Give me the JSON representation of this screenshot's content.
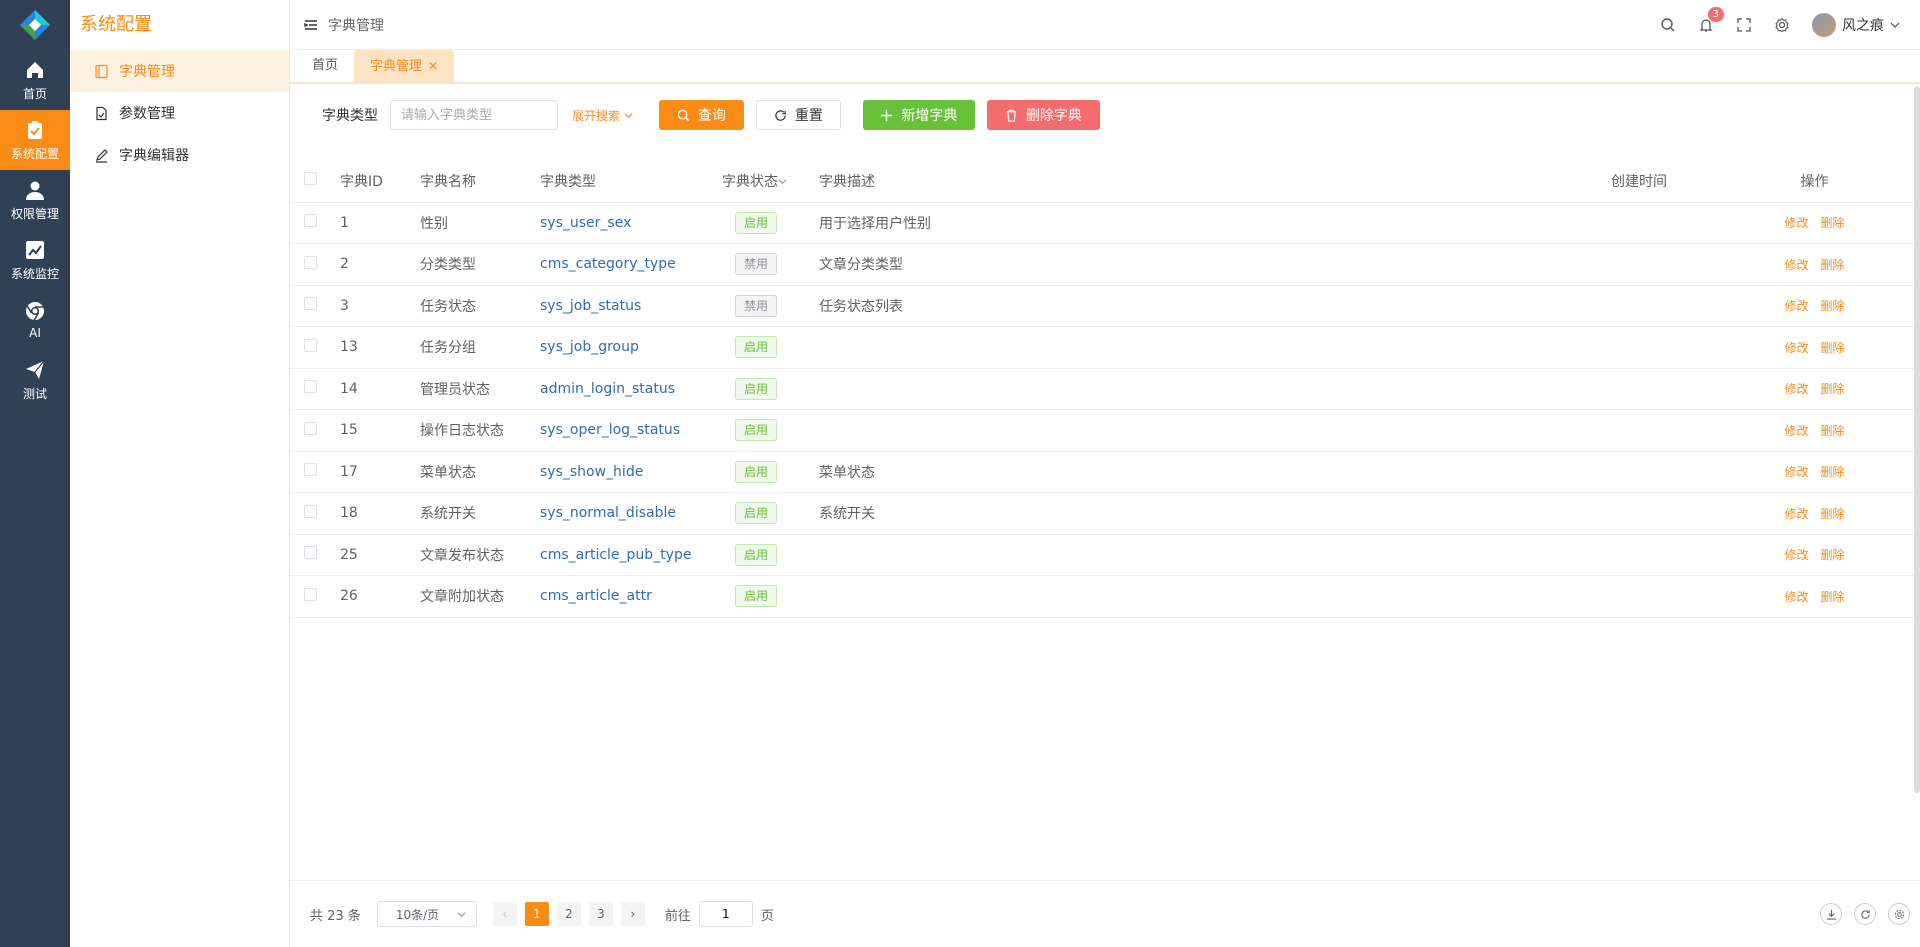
{
  "rail": {
    "items": [
      {
        "label": "首页",
        "icon": "home-icon"
      },
      {
        "label": "系统配置",
        "icon": "clipboard-check-icon",
        "active": true
      },
      {
        "label": "权限管理",
        "icon": "user-icon"
      },
      {
        "label": "系统监控",
        "icon": "chart-line-icon"
      },
      {
        "label": "AI",
        "icon": "chrome-icon"
      },
      {
        "label": "测试",
        "icon": "paper-plane-icon"
      }
    ]
  },
  "submenu": {
    "title": "系统配置",
    "items": [
      {
        "label": "字典管理",
        "active": true
      },
      {
        "label": "参数管理"
      },
      {
        "label": "字典编辑器"
      }
    ]
  },
  "header": {
    "breadcrumb": "字典管理",
    "notification_count": "3",
    "username": "风之痕"
  },
  "tabs": [
    {
      "label": "首页"
    },
    {
      "label": "字典管理",
      "active": true
    }
  ],
  "search": {
    "label": "字典类型",
    "placeholder": "请输入字典类型",
    "value": "",
    "expand_label": "展开搜索",
    "query_label": "查询",
    "reset_label": "重置",
    "add_label": "新增字典",
    "delete_label": "删除字典"
  },
  "table": {
    "headers": {
      "id": "字典ID",
      "name": "字典名称",
      "type": "字典类型",
      "state": "字典状态",
      "desc": "字典描述",
      "time": "创建时间",
      "op": "操作"
    },
    "edit_label": "修改",
    "delete_label": "删除",
    "rows": [
      {
        "id": "1",
        "name": "性别",
        "type": "sys_user_sex",
        "state": "启用",
        "on": true,
        "desc": "用于选择用户性别",
        "time": ""
      },
      {
        "id": "2",
        "name": "分类类型",
        "type": "cms_category_type",
        "state": "禁用",
        "on": false,
        "desc": "文章分类类型",
        "time": ""
      },
      {
        "id": "3",
        "name": "任务状态",
        "type": "sys_job_status",
        "state": "禁用",
        "on": false,
        "desc": "任务状态列表",
        "time": ""
      },
      {
        "id": "13",
        "name": "任务分组",
        "type": "sys_job_group",
        "state": "启用",
        "on": true,
        "desc": "",
        "time": ""
      },
      {
        "id": "14",
        "name": "管理员状态",
        "type": "admin_login_status",
        "state": "启用",
        "on": true,
        "desc": "",
        "time": ""
      },
      {
        "id": "15",
        "name": "操作日志状态",
        "type": "sys_oper_log_status",
        "state": "启用",
        "on": true,
        "desc": "",
        "time": ""
      },
      {
        "id": "17",
        "name": "菜单状态",
        "type": "sys_show_hide",
        "state": "启用",
        "on": true,
        "desc": "菜单状态",
        "time": ""
      },
      {
        "id": "18",
        "name": "系统开关",
        "type": "sys_normal_disable",
        "state": "启用",
        "on": true,
        "desc": "系统开关",
        "time": ""
      },
      {
        "id": "25",
        "name": "文章发布状态",
        "type": "cms_article_pub_type",
        "state": "启用",
        "on": true,
        "desc": "",
        "time": ""
      },
      {
        "id": "26",
        "name": "文章附加状态",
        "type": "cms_article_attr",
        "state": "启用",
        "on": true,
        "desc": "",
        "time": ""
      }
    ]
  },
  "pagination": {
    "total": "共 23 条",
    "page_size": "10条/页",
    "pages": [
      "1",
      "2",
      "3"
    ],
    "current": "1",
    "goto_label": "前往",
    "goto_value": "1",
    "page_suffix": "页"
  },
  "colors": {
    "accent": "#fa8c16",
    "sidebar": "#304156",
    "success": "#67c23a",
    "danger": "#f56c6c",
    "link": "#2c6eaf"
  }
}
